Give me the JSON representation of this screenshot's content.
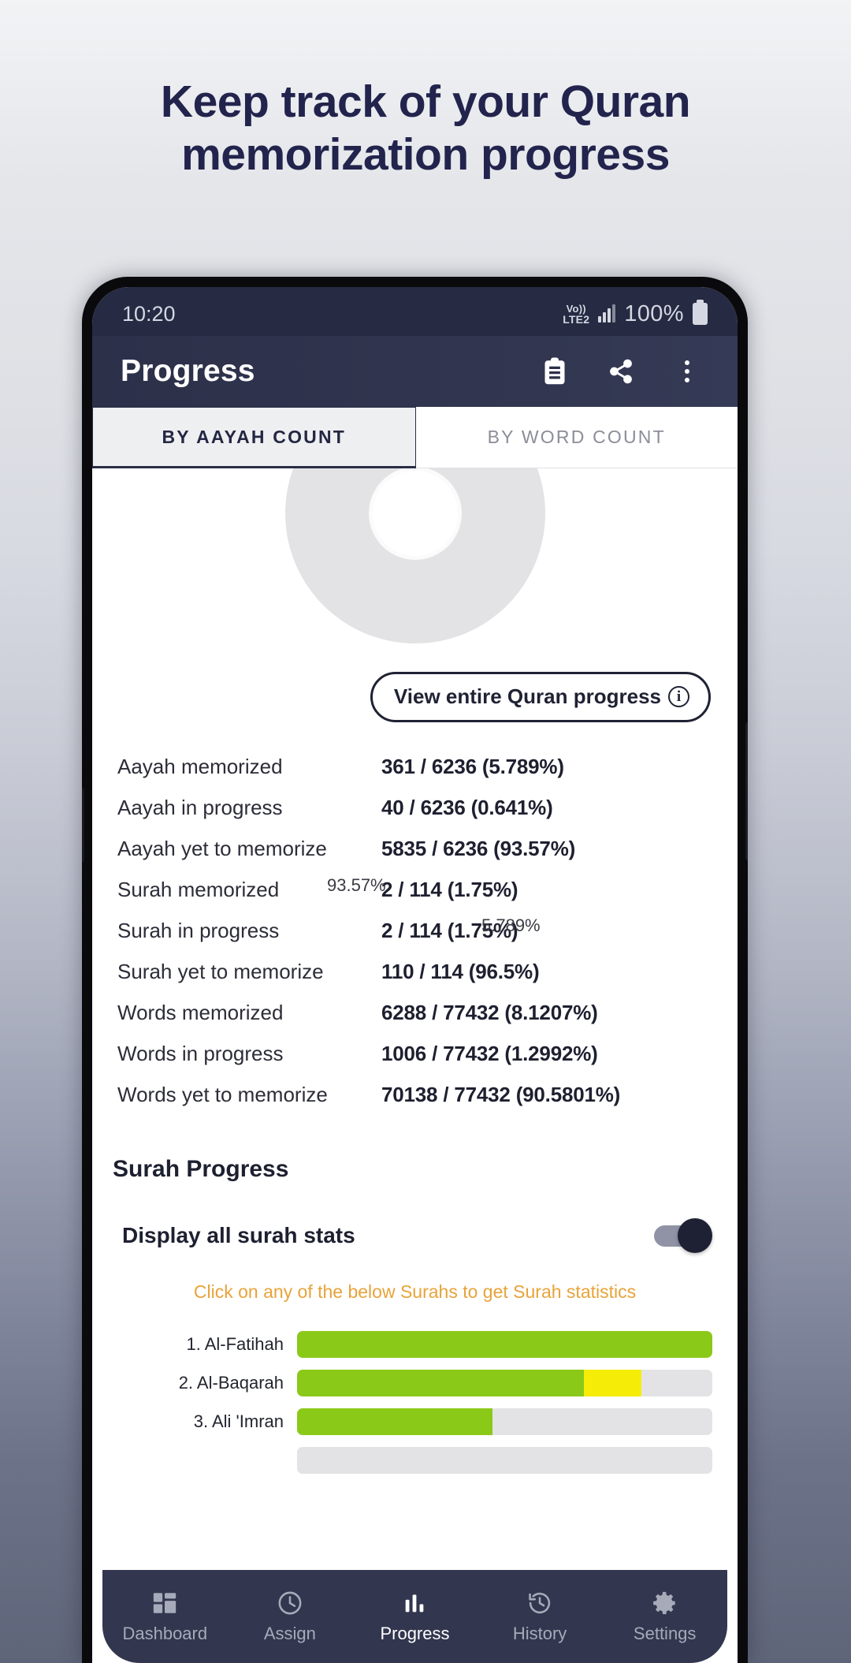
{
  "headline": "Keep track of your Quran memorization progress",
  "status_bar": {
    "time": "10:20",
    "network": "Vo))",
    "network_sub": "LTE2",
    "battery_percent": "100%"
  },
  "app_bar": {
    "title": "Progress",
    "actions": [
      "clipboard-icon",
      "share-icon",
      "overflow-menu-icon"
    ]
  },
  "tabs": [
    {
      "label": "BY AAYAH COUNT",
      "active": true
    },
    {
      "label": "BY WORD COUNT",
      "active": false
    }
  ],
  "chart_data": {
    "type": "pie",
    "title": "",
    "labels": [
      "Memorized",
      "In progress",
      "Yet to memorize"
    ],
    "values": [
      5.789,
      0.641,
      93.57
    ],
    "value_labels": [
      "5.789%",
      "0.641%",
      "93.57%"
    ],
    "visible_labels": [
      "93.57%",
      "5.789%"
    ],
    "colors": [
      "#8bc919",
      "#f5ec07",
      "#e3e3e5"
    ],
    "donut": true,
    "legend": "none"
  },
  "view_button": {
    "label": "View entire Quran progress",
    "icon": "info-icon"
  },
  "stats": [
    {
      "key": "Aayah memorized",
      "value": "361 / 6236 (5.789%)"
    },
    {
      "key": "Aayah in progress",
      "value": "40 / 6236 (0.641%)"
    },
    {
      "key": "Aayah yet to memorize",
      "value": "5835 / 6236 (93.57%)"
    },
    {
      "key": "Surah memorized",
      "value": "2 / 114 (1.75%)"
    },
    {
      "key": "Surah in progress",
      "value": "2 / 114 (1.75%)"
    },
    {
      "key": "Surah yet to memorize",
      "value": "110 / 114 (96.5%)"
    },
    {
      "key": "Words memorized",
      "value": "6288 / 77432 (8.1207%)"
    },
    {
      "key": "Words in progress",
      "value": "1006 / 77432 (1.2992%)"
    },
    {
      "key": "Words yet to memorize",
      "value": "70138 / 77432 (90.5801%)"
    }
  ],
  "surah_progress": {
    "title": "Surah Progress",
    "toggle_label": "Display all surah stats",
    "toggle_on": true,
    "hint": "Click on any of the below Surahs to get Surah statistics",
    "rows": [
      {
        "name": "1. Al-Fatihah",
        "green": 100,
        "yellow": 0
      },
      {
        "name": "2. Al-Baqarah",
        "green": 69,
        "yellow": 14
      },
      {
        "name": "3. Ali 'Imran",
        "green": 47,
        "yellow": 0
      },
      {
        "name": "",
        "green": 0,
        "yellow": 0
      }
    ]
  },
  "bottom_nav": [
    {
      "label": "Dashboard",
      "icon": "dashboard-icon",
      "active": false
    },
    {
      "label": "Assign",
      "icon": "clock-icon",
      "active": false
    },
    {
      "label": "Progress",
      "icon": "bar-chart-icon",
      "active": true
    },
    {
      "label": "History",
      "icon": "history-icon",
      "active": false
    },
    {
      "label": "Settings",
      "icon": "gear-icon",
      "active": false
    }
  ],
  "colors": {
    "memorized": "#8bc919",
    "in_progress": "#f5ec07",
    "remaining": "#e3e3e5",
    "app_bar": "#2b2f49",
    "accent_hint": "#e8a33a"
  }
}
